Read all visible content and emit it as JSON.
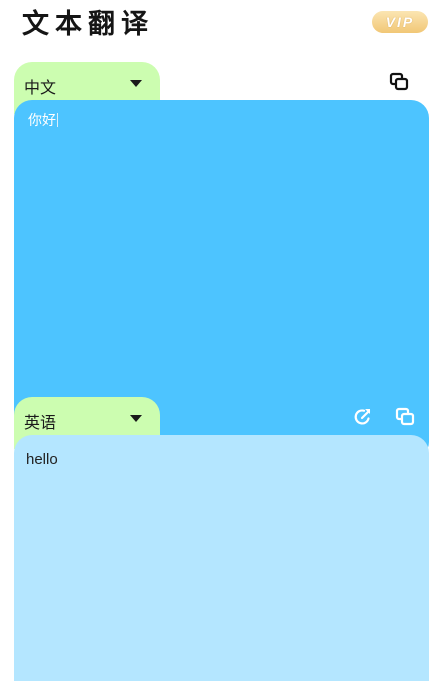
{
  "app": {
    "title": "文本翻译",
    "vip_label": "VIP"
  },
  "source": {
    "language": "中文",
    "text": "你好"
  },
  "target": {
    "language": "英语",
    "text": "hello"
  },
  "icons": {
    "source_copy": "copy-icon",
    "target_share": "share-icon",
    "target_copy": "copy-icon"
  },
  "colors": {
    "tab_bg": "#ccfdb0",
    "source_panel": "#4dc4ff",
    "target_panel": "#b4e6ff",
    "vip_gold": "#f1c776"
  }
}
